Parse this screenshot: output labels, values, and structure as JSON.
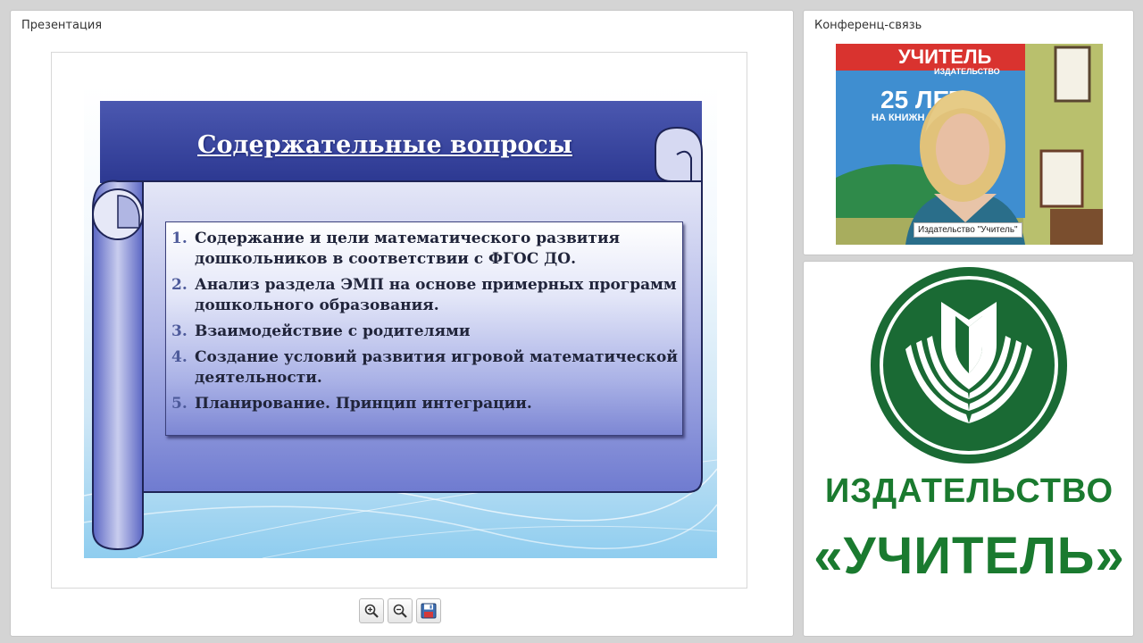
{
  "panels": {
    "presentation_title": "Презентация",
    "conference_title": "Конференц-связь"
  },
  "slide": {
    "title": "Содержательные вопросы",
    "items": [
      {
        "num": "1.",
        "text": "Содержание и цели математического развития дошкольников  в соответствии с ФГОС ДО."
      },
      {
        "num": "2.",
        "text": "Анализ раздела ЭМП на основе примерных программ дошкольного образования."
      },
      {
        "num": "3.",
        "text": "Взаимодействие с родителями"
      },
      {
        "num": "4.",
        "text": "Создание  условий развития  игровой математической деятельности."
      },
      {
        "num": "5.",
        "text": "Планирование. Принцип интеграции."
      }
    ]
  },
  "video": {
    "caption": "Издательство \"Учитель\"",
    "poster_text_1": "УЧИТЕЛЬ",
    "poster_text_2": "ИЗДАТЕЛЬСТВО",
    "poster_text_3": "25 ЛЕТ",
    "poster_text_4": "НА КНИЖН"
  },
  "logo": {
    "line1": "ИЗДАТЕЛЬСТВО",
    "line2": "«УЧИТЕЛЬ»",
    "color": "#1a7a2f"
  },
  "toolbar": {
    "zoom_in_icon": "zoom-in-icon",
    "zoom_out_icon": "zoom-out-icon",
    "save_icon": "floppy-disk-icon"
  }
}
